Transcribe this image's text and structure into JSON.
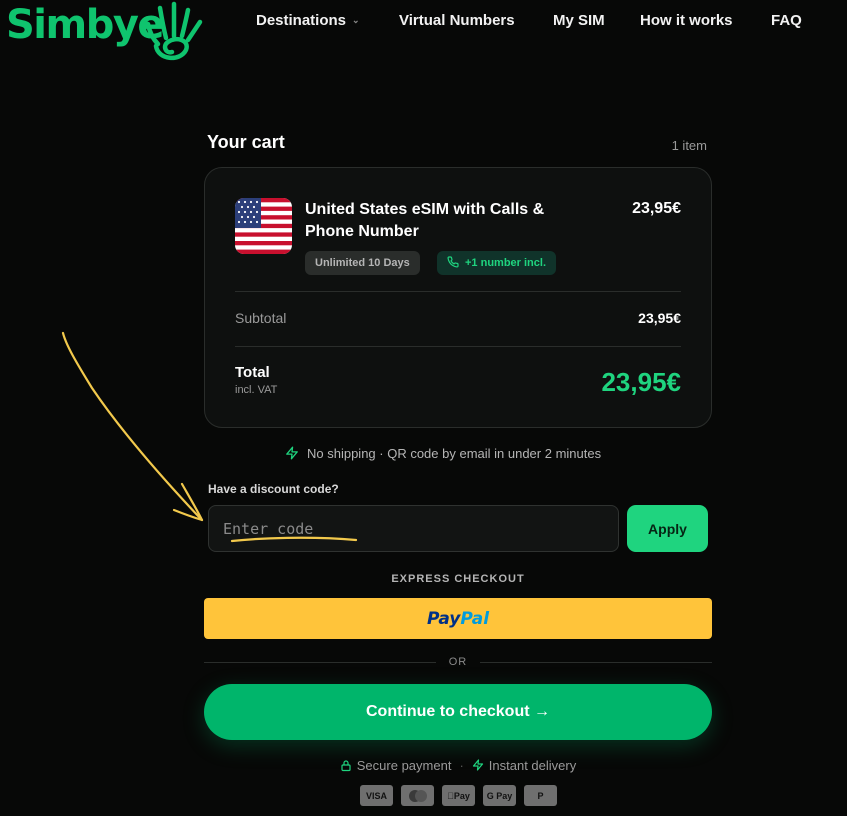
{
  "brand": {
    "name": "Simbye"
  },
  "nav": {
    "destinations": "Destinations",
    "virtual_numbers": "Virtual Numbers",
    "my_sim": "My SIM",
    "how_it_works": "How it works",
    "faq": "FAQ"
  },
  "cart": {
    "title": "Your cart",
    "item_count": "1 item",
    "product": {
      "name": "United States eSIM with Calls & Phone Number",
      "price": "23,95€",
      "flag_icon": "us-flag-icon",
      "tags": {
        "duration": "Unlimited 10 Days",
        "number": "+1 number incl."
      }
    },
    "subtotal_label": "Subtotal",
    "subtotal_value": "23,95€",
    "total_label": "Total",
    "vat_label": "incl. VAT",
    "total_value": "23,95€"
  },
  "shipping_note": "No shipping · QR code by email in under 2 minutes",
  "discount": {
    "label": "Have a discount code?",
    "placeholder": "Enter code",
    "value": "",
    "apply_label": "Apply"
  },
  "express": {
    "label": "EXPRESS CHECKOUT",
    "paypal_part1": "Pay",
    "paypal_part2": "Pal"
  },
  "or_label": "OR",
  "checkout": {
    "label": "Continue to checkout",
    "arrow": "→"
  },
  "trust": {
    "secure": "Secure payment",
    "sep": "·",
    "instant": "Instant delivery"
  },
  "payment_methods": [
    "VISA",
    "",
    "Pay",
    "G Pay",
    "P"
  ],
  "colors": {
    "accent": "#1fd47f",
    "checkout": "#00b56b",
    "paypal": "#ffc43a",
    "background": "#070807",
    "annotation": "#f2c94c"
  }
}
